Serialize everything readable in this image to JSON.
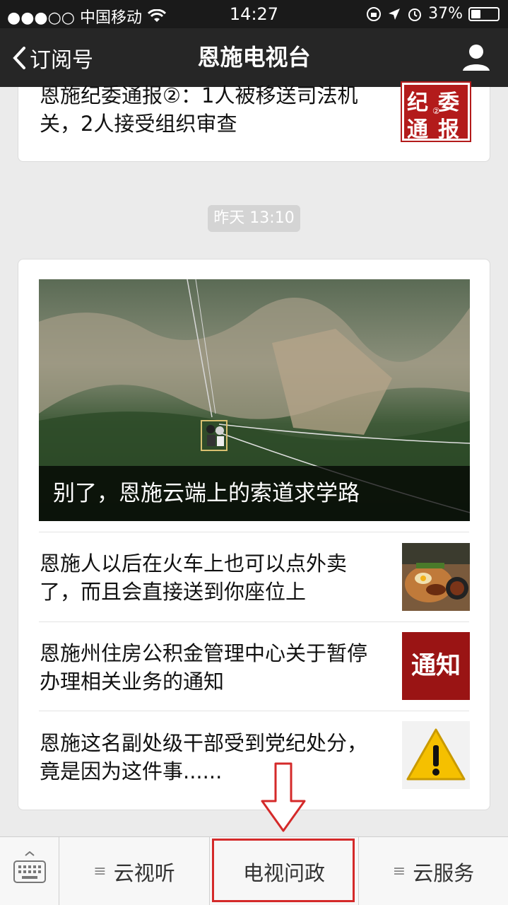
{
  "status_bar": {
    "carrier": "●●●○○ 中国移动",
    "time": "14:27",
    "battery": "37%",
    "battery_level": 0.37
  },
  "nav": {
    "back_label": "订阅号",
    "title": "恩施电视台"
  },
  "top_article": {
    "title": "恩施纪委通报②：1人被移送司法机关，2人接受组织审查",
    "thumb_text": [
      "纪",
      "委",
      "通",
      "报"
    ],
    "thumb_badge": "②"
  },
  "timestamp": "昨天 13:10",
  "main_card": {
    "hero_caption": "别了，恩施云端上的索道求学路",
    "articles": [
      {
        "title": "恩施人以后在火车上也可以点外卖了，而且会直接送到你座位上"
      },
      {
        "title": "恩施州住房公积金管理中心关于暂停办理相关业务的通知",
        "thumb_text": "通知"
      },
      {
        "title": "恩施这名副处级干部受到党纪处分，竟是因为这件事......"
      }
    ]
  },
  "tab_bar": {
    "tabs": [
      {
        "label": "云视听",
        "menu_glyph": "≡"
      },
      {
        "label": "电视问政"
      },
      {
        "label": "云服务",
        "menu_glyph": "≡"
      }
    ]
  },
  "colors": {
    "nav_bg": "#262626",
    "highlight": "#d42a2a",
    "notice_red": "#9a1414"
  },
  "icons": [
    "wifi-icon",
    "back-chevron-icon",
    "profile-icon",
    "keyboard-icon",
    "warning-icon",
    "down-arrow-icon"
  ]
}
